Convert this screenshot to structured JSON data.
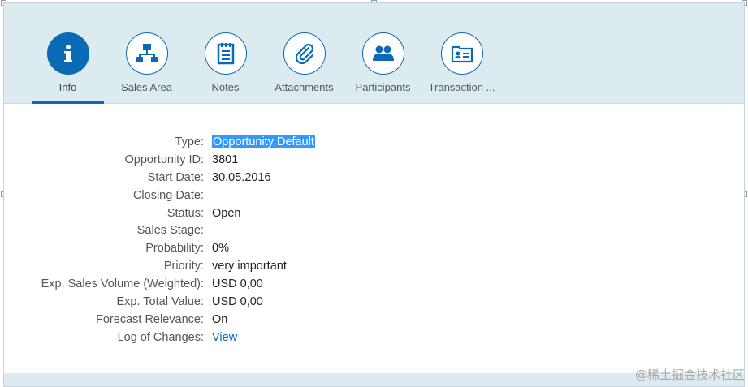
{
  "tabs": [
    {
      "label": "Info",
      "icon": "info-icon",
      "active": true
    },
    {
      "label": "Sales Area",
      "icon": "org-structure-icon",
      "active": false
    },
    {
      "label": "Notes",
      "icon": "notes-icon",
      "active": false
    },
    {
      "label": "Attachments",
      "icon": "paperclip-icon",
      "active": false
    },
    {
      "label": "Participants",
      "icon": "people-icon",
      "active": false
    },
    {
      "label": "Transaction ...",
      "icon": "contact-card-icon",
      "active": false
    }
  ],
  "fields": [
    {
      "label": "Type:",
      "value": "Opportunity Default"
    },
    {
      "label": "Opportunity ID:",
      "value": "3801"
    },
    {
      "label": "Start Date:",
      "value": "30.05.2016"
    },
    {
      "label": "Closing Date:",
      "value": ""
    },
    {
      "label": "Status:",
      "value": "Open"
    },
    {
      "label": "Sales Stage:",
      "value": ""
    },
    {
      "label": "Probability:",
      "value": "0%"
    },
    {
      "label": "Priority:",
      "value": "very important"
    },
    {
      "label": "Exp. Sales Volume (Weighted):",
      "value": "USD 0,00"
    },
    {
      "label": "Exp. Total Value:",
      "value": "USD 0,00"
    },
    {
      "label": "Forecast Relevance:",
      "value": "On"
    },
    {
      "label": "Log of Changes:",
      "value": "View"
    }
  ],
  "watermark": "@稀土掘金技术社区",
  "colors": {
    "accent": "#0a6ab5",
    "header_bg": "#dcebef",
    "selection": "#3399ff"
  }
}
